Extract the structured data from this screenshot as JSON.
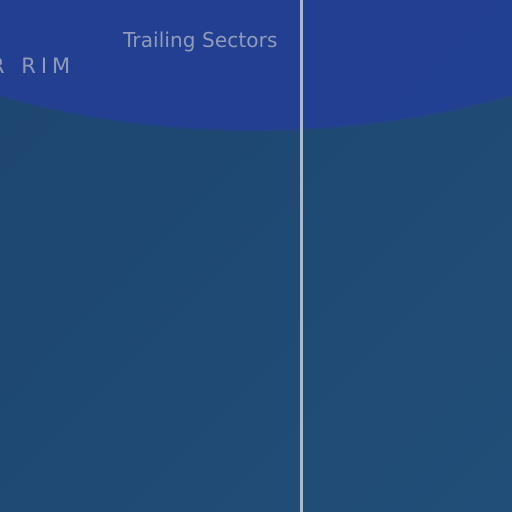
{
  "map": {
    "labels": {
      "trailing_sectors": "Trailing Sectors",
      "rim": "R RIM"
    },
    "colors": {
      "background": "#1e4670",
      "region_band": "#233f93",
      "divider_line": "#b9c4d6",
      "label_text": "#8f9bb8"
    }
  }
}
